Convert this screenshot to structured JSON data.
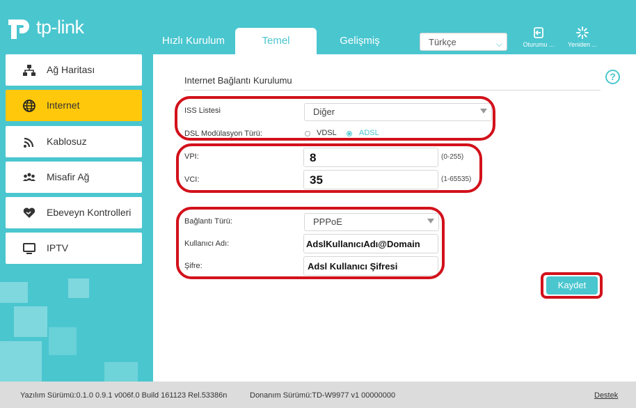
{
  "header": {
    "logo_text": "tp-link",
    "tabs": [
      {
        "label": "Hızlı Kurulum"
      },
      {
        "label": "Temel"
      },
      {
        "label": "Gelişmiş"
      }
    ],
    "language": "Türkçe",
    "logout_label": "Oturumu ...",
    "reboot_label": "Yeniden ..."
  },
  "sidebar": {
    "items": [
      {
        "label": "Ağ Haritası",
        "icon": "network-map-icon"
      },
      {
        "label": "Internet",
        "icon": "globe-icon"
      },
      {
        "label": "Kablosuz",
        "icon": "wireless-icon"
      },
      {
        "label": "Misafir Ağ",
        "icon": "guest-network-icon"
      },
      {
        "label": "Ebeveyn Kontrolleri",
        "icon": "parental-control-icon"
      },
      {
        "label": "IPTV",
        "icon": "tv-icon"
      }
    ]
  },
  "main": {
    "title": "Internet Bağlantı Kurulumu",
    "help": "?",
    "isp_label": "ISS Listesi",
    "isp_value": "Diğer",
    "dsl_label": "DSL Modülasyon Türü:",
    "dsl_options": [
      "VDSL",
      "ADSL"
    ],
    "dsl_selected": "ADSL",
    "vpi_label": "VPI:",
    "vpi_value": "8",
    "vpi_range": "(0-255)",
    "vci_label": "VCI:",
    "vci_value": "35",
    "vci_range": "(1-65535)",
    "conn_label": "Bağlantı Türü:",
    "conn_value": "PPPoE",
    "user_label": "Kullanıcı Adı:",
    "user_value": "AdslKullanıcıAdı@Domain",
    "pass_label": "Şifre:",
    "pass_value": "Adsl Kullanıcı Şifresi",
    "save_label": "Kaydet"
  },
  "footer": {
    "firmware": "Yazılım Sürümü:0.1.0 0.9.1 v006f.0 Build 161123 Rel.53386n",
    "hardware": "Donanım Sürümü:TD-W9977 v1 00000000",
    "support": "Destek"
  },
  "colors": {
    "accent": "#4ac6cf",
    "active_item": "#ffc80a",
    "highlight_ring": "#d2111b"
  }
}
